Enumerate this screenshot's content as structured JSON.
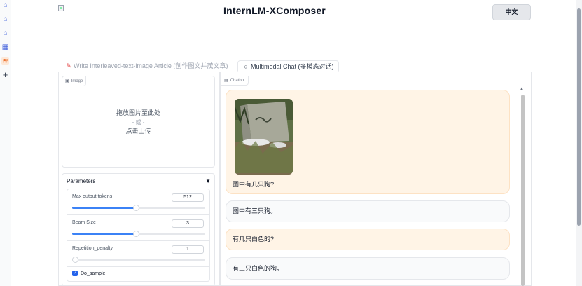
{
  "app": {
    "title": "InternLM-XComposer",
    "language_button": "中文"
  },
  "rail": {
    "icons": [
      "castle-icon",
      "castle-icon",
      "castle-icon",
      "calendar-icon",
      "sliders-icon",
      "plus-icon"
    ]
  },
  "tabs": [
    {
      "label": "Write Interleaved-text-image Article (创作图文并茂文章)",
      "icon": "edit-icon"
    },
    {
      "label": "Multimodal Chat (多模态对话)",
      "icon": "chat-bubble-icon"
    }
  ],
  "image_input": {
    "label": "Image",
    "drop_text": "拖放图片至此处",
    "or_text": "- 或 -",
    "click_text": "点击上传"
  },
  "parameters": {
    "title": "Parameters",
    "caret": "▼",
    "sliders": [
      {
        "label": "Max output tokens",
        "value": "512",
        "fraction": 0.48
      },
      {
        "label": "Beam Size",
        "value": "3",
        "fraction": 0.48
      },
      {
        "label": "Repetition_penalty",
        "value": "1",
        "fraction": 0.0
      }
    ],
    "do_sample": {
      "label": "Do_sample",
      "checked": true
    }
  },
  "chatbot": {
    "label": "Chatbot",
    "messages": [
      {
        "role": "user",
        "text": "图中有几只狗?",
        "has_image": true
      },
      {
        "role": "bot",
        "text": "图中有三只狗。"
      },
      {
        "role": "user",
        "text": "有几只白色的?"
      },
      {
        "role": "bot",
        "text": "有三只白色的狗。"
      }
    ]
  },
  "colors": {
    "accent": "#3b82f6",
    "user_bubble": "#fff4e6",
    "bot_bubble": "#f9fafb"
  }
}
